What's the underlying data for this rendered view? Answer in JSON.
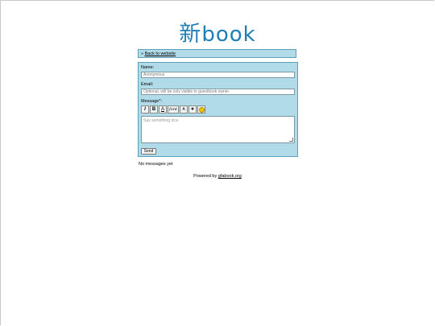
{
  "logo": {
    "cjk": "新",
    "text": "book"
  },
  "topbar": {
    "prefix": "» ",
    "back_link": "Back to website"
  },
  "form": {
    "name_label": "Name:",
    "name_placeholder": "Anonymous",
    "email_label": "Email:",
    "email_placeholder": "Optional, will be only visible to guestbook owner",
    "message_label": "Message*:",
    "message_placeholder": "Say something nice",
    "send_label": "Send"
  },
  "toolbar": [
    {
      "name": "italic-button",
      "glyph": "I"
    },
    {
      "name": "bold-button",
      "glyph": "B"
    },
    {
      "name": "underline-button",
      "glyph": "A"
    },
    {
      "name": "font-button",
      "glyph": "font"
    },
    {
      "name": "font-size-button",
      "glyph": "A"
    },
    {
      "name": "color-button",
      "glyph": "●"
    },
    {
      "name": "smiley-button",
      "glyph": ""
    }
  ],
  "messages": {
    "empty_text": "No messages yet"
  },
  "footer": {
    "prefix": "Powered by ",
    "link": "gfabook.org"
  }
}
